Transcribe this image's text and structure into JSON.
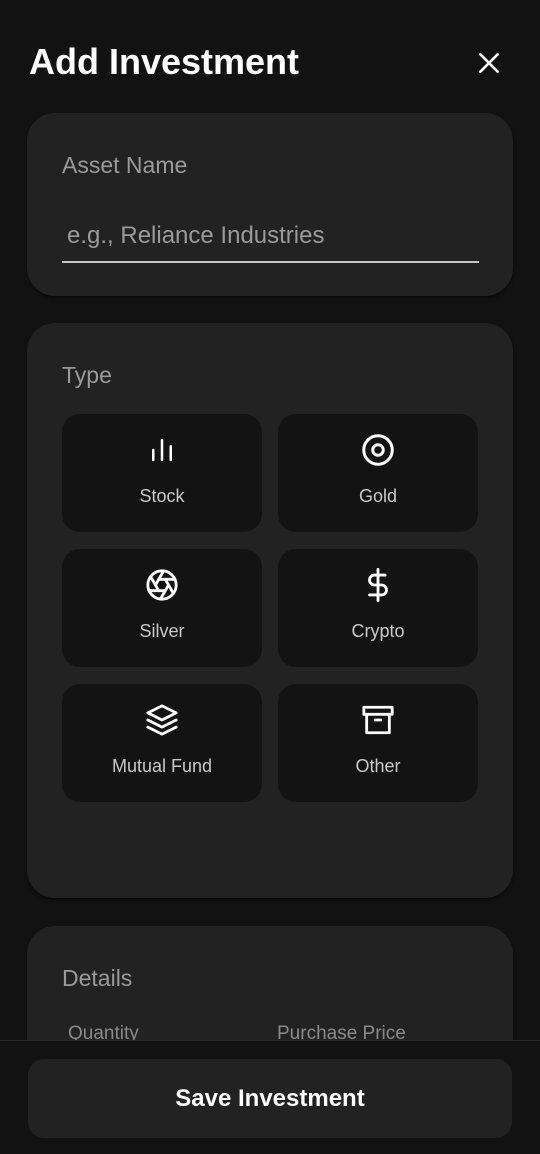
{
  "header": {
    "title": "Add Investment",
    "close_icon": "close-icon"
  },
  "asset": {
    "label": "Asset Name",
    "placeholder": "e.g., Reliance Industries",
    "value": ""
  },
  "type": {
    "label": "Type",
    "options": [
      {
        "label": "Stock",
        "icon": "bar-chart-icon"
      },
      {
        "label": "Gold",
        "icon": "target-icon"
      },
      {
        "label": "Silver",
        "icon": "aperture-icon"
      },
      {
        "label": "Crypto",
        "icon": "dollar-icon"
      },
      {
        "label": "Mutual Fund",
        "icon": "layers-icon"
      },
      {
        "label": "Other",
        "icon": "archive-icon"
      }
    ]
  },
  "details": {
    "label": "Details",
    "quantity_label": "Quantity",
    "purchase_price_label": "Purchase Price"
  },
  "footer": {
    "save_label": "Save Investment"
  },
  "colors": {
    "background": "#121212",
    "card": "#222222",
    "tile": "#131313",
    "muted_text": "#9a9a9a"
  }
}
